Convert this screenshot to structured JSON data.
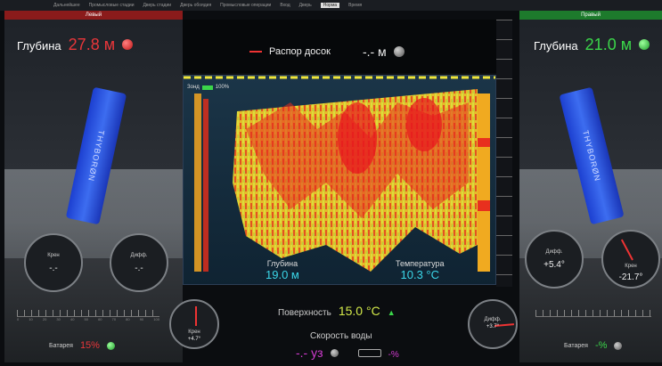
{
  "menu": [
    "Дальнейшее",
    "Промысловые стадии",
    "Дверь стадии",
    "Дверь обоядия",
    "Промысловые операции",
    "Вход",
    "Дверь",
    "Норма",
    "Время"
  ],
  "menu_active": "Норма",
  "left": {
    "header": "Левый",
    "depth_label": "Глубина",
    "depth_value": "27.8 м",
    "door_brand": "THYBORØN",
    "gauge_roll_label": "Крен",
    "gauge_roll_value": "-.-",
    "gauge_diff_label": "Дифф.",
    "gauge_diff_value": "-.-",
    "battery_label": "Батарея",
    "battery_value": "15%",
    "scale_nums": [
      "0",
      "10",
      "20",
      "30",
      "40",
      "50",
      "60",
      "70",
      "80",
      "90",
      "100"
    ],
    "mini_gauge_label": "Крен",
    "mini_gauge_value": "+4.7°"
  },
  "right": {
    "header": "Правый",
    "depth_label": "Глубина",
    "depth_value": "21.0 м",
    "door_brand": "THYBORØN",
    "gauge_diff_label": "Дифф.",
    "gauge_diff_value": "+5.4°",
    "gauge_roll_label": "Крен",
    "gauge_roll_value": "-21.7°",
    "battery_label": "Батарея",
    "battery_value": "-%",
    "mini_gauge_label": "Дифф.",
    "mini_gauge_value": "+3.7°"
  },
  "center": {
    "spread_label": "Распор досок",
    "spread_value": "-.- м",
    "sonar_label": "Зонд",
    "sonar_level": "100%",
    "sonar_depth_label": "Глубина",
    "sonar_depth_value": "19.0 м",
    "sonar_temp_label": "Температура",
    "sonar_temp_value": "10.3 °C",
    "surface_label": "Поверхность",
    "surface_value": "15.0 °C",
    "water_speed_label": "Скорость воды",
    "water_speed_value": "-.- уз",
    "water_speed_pct": "-%"
  },
  "colors": {
    "left_accent": "#e8363a",
    "right_accent": "#3bd64a",
    "left_header": "#8a1b1b",
    "right_header": "#1d7a2c"
  }
}
